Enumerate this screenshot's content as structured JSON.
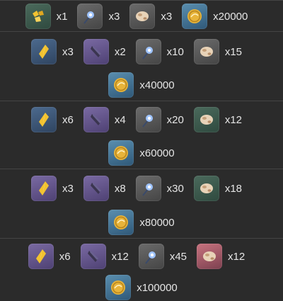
{
  "tiers": [
    {
      "items": [
        {
          "icon": "gold-nuggets-icon",
          "qty": "x1",
          "quality": "green"
        },
        {
          "icon": "blue-crystal-flower-icon",
          "qty": "x3",
          "quality": "grey"
        },
        {
          "icon": "beast-bone-icon",
          "qty": "x3",
          "quality": "grey"
        },
        {
          "icon": "coin-icon",
          "qty": "x20000",
          "quality": "blue"
        }
      ],
      "coin_qty": null
    },
    {
      "items": [
        {
          "icon": "gold-shard-icon",
          "qty": "x3",
          "quality": "blue"
        },
        {
          "icon": "dark-claw-icon",
          "qty": "x2",
          "quality": "purple"
        },
        {
          "icon": "blue-crystal-flower-icon",
          "qty": "x10",
          "quality": "grey"
        },
        {
          "icon": "beast-bone-icon",
          "qty": "x15",
          "quality": "grey"
        }
      ],
      "coin_qty": "x40000"
    },
    {
      "items": [
        {
          "icon": "gold-shard-icon",
          "qty": "x6",
          "quality": "blue"
        },
        {
          "icon": "dark-claw-icon",
          "qty": "x4",
          "quality": "purple"
        },
        {
          "icon": "blue-crystal-flower-icon",
          "qty": "x20",
          "quality": "grey"
        },
        {
          "icon": "beast-bone-icon",
          "qty": "x12",
          "quality": "green"
        }
      ],
      "coin_qty": "x60000"
    },
    {
      "items": [
        {
          "icon": "gold-shard-icon",
          "qty": "x3",
          "quality": "purple"
        },
        {
          "icon": "dark-claw-icon",
          "qty": "x8",
          "quality": "purple"
        },
        {
          "icon": "blue-crystal-flower-icon",
          "qty": "x30",
          "quality": "grey"
        },
        {
          "icon": "beast-bone-icon",
          "qty": "x18",
          "quality": "green"
        }
      ],
      "coin_qty": "x80000"
    },
    {
      "items": [
        {
          "icon": "gold-shard-icon",
          "qty": "x6",
          "quality": "purple"
        },
        {
          "icon": "dark-claw-icon",
          "qty": "x12",
          "quality": "purple"
        },
        {
          "icon": "blue-crystal-flower-icon",
          "qty": "x45",
          "quality": "grey"
        },
        {
          "icon": "beast-bone-icon",
          "qty": "x12",
          "quality": "pink"
        }
      ],
      "coin_qty": "x100000"
    }
  ],
  "colors": {
    "background": "#2b2b2b",
    "divider": "#444444",
    "text": "#e6e6e6"
  }
}
